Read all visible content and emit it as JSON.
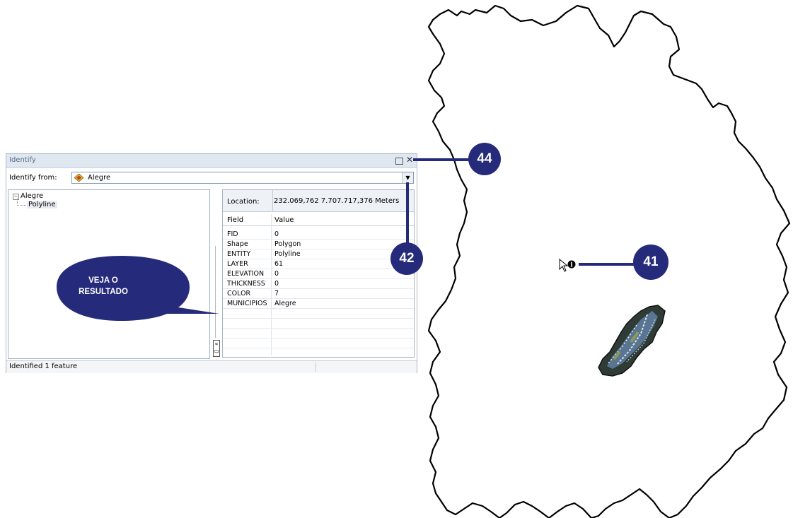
{
  "window": {
    "title": "Identify",
    "identify_from_label": "Identify from:",
    "identify_from_value": "Alegre",
    "status": "Identified 1 feature"
  },
  "tree": {
    "root": "Alegre",
    "child": "Polyline"
  },
  "details": {
    "location_label": "Location:",
    "location_value": "232.069,762  7.707.717,376 Meters",
    "col_field": "Field",
    "col_value": "Value",
    "rows": [
      {
        "field": "FID",
        "value": "0"
      },
      {
        "field": "Shape",
        "value": "Polygon"
      },
      {
        "field": "ENTITY",
        "value": "Polyline"
      },
      {
        "field": "LAYER",
        "value": "61"
      },
      {
        "field": "ELEVATION",
        "value": "0"
      },
      {
        "field": "THICKNESS",
        "value": "0"
      },
      {
        "field": "COLOR",
        "value": "7"
      },
      {
        "field": "MUNICIPIOS",
        "value": "Alegre"
      }
    ]
  },
  "callouts": {
    "c44": "44",
    "c42": "42",
    "c41": "41",
    "speech_line1": "VEJA O",
    "speech_line2": "RESULTADO"
  },
  "colors": {
    "callout": "#252a7a",
    "titlebar": "#dfe7f1"
  }
}
